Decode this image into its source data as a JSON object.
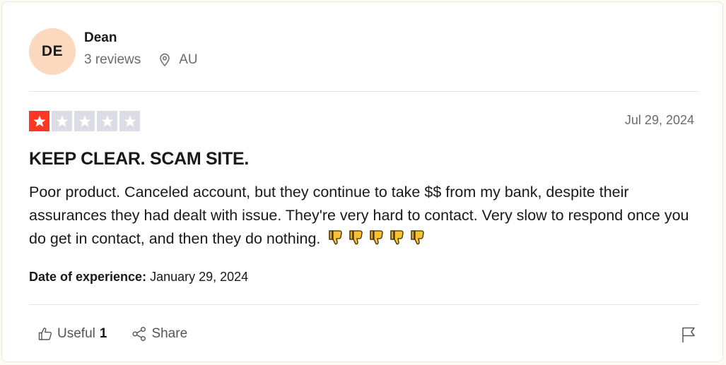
{
  "review": {
    "user": {
      "initials": "DE",
      "name": "Dean",
      "reviews": "3 reviews",
      "location": "AU",
      "avatar_color": "#fcd9be"
    },
    "rating": 1,
    "rating_max": 5,
    "star_filled_color": "#ff3722",
    "star_empty_color": "#dcdce6",
    "date": "Jul 29, 2024",
    "title": "KEEP CLEAR. SCAM SITE.",
    "body": "Poor product. Canceled account, but they continue to take $$ from my bank, despite their assurances they had dealt with issue. They're very hard to contact. Very slow to respond once you do get in contact, and then they do nothing.",
    "body_emoji": [
      "thumbs-down-emoji",
      "thumbs-down-emoji",
      "thumbs-down-emoji",
      "thumbs-down-emoji",
      "thumbs-down-emoji"
    ],
    "experience_label": "Date of experience:",
    "experience_date": "January 29, 2024"
  },
  "actions": {
    "useful_label": "Useful",
    "useful_count": "1",
    "share_label": "Share",
    "flag_icon": "flag-icon"
  }
}
